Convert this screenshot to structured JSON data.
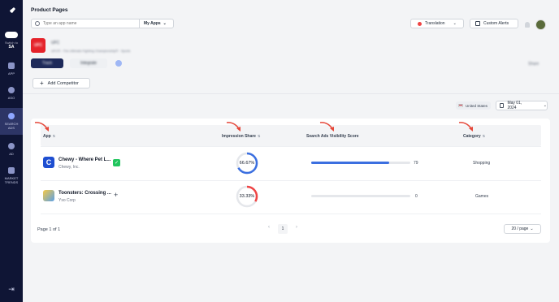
{
  "sidebar": {
    "switch_label": "Switch to",
    "switch_value": "SA",
    "items": [
      {
        "label": "APP",
        "icon": "app-icon"
      },
      {
        "label": "ASO",
        "icon": "aso-icon"
      },
      {
        "label": "SEARCH ADS",
        "icon": "search-ads-icon",
        "active": true
      },
      {
        "label": "AD",
        "icon": "ad-icon"
      },
      {
        "label": "MARKET TRENDS",
        "icon": "market-trends-icon"
      }
    ]
  },
  "header": {
    "title": "Product Pages",
    "search_placeholder": "Type an app name",
    "scope": "My Apps",
    "translation": "Translation",
    "custom_alerts": "Custom Alerts"
  },
  "app": {
    "icon_text": "UFC",
    "name": "UFC",
    "subtitle": "UFC® - The Ultimate Fighting Championship® · Sports",
    "track": "Track",
    "integrate": "Integrate",
    "share": "Share"
  },
  "add_competitor": "Add Competitor",
  "filters": {
    "country": "United States",
    "date": "May 01, 2024"
  },
  "table": {
    "columns": [
      "App",
      "Impression Share",
      "Search Ads Visibility Score",
      "Category"
    ],
    "rows": [
      {
        "name": "Chewy - Where Pet L...",
        "developer": "Chewy, Inc.",
        "impression_share": "66.67%",
        "share_value": 66.67,
        "score": "79",
        "score_value": 79,
        "category": "Shopping",
        "tracked": true
      },
      {
        "name": "Toonsters: Crossing ...",
        "developer": "Yso Corp",
        "impression_share": "33.33%",
        "share_value": 33.33,
        "score": "0",
        "score_value": 0,
        "category": "Games",
        "tracked": false
      }
    ]
  },
  "pagination": {
    "summary": "Page 1 of 1",
    "current": "1",
    "per_page": "20 / page"
  },
  "colors": {
    "sidebar": "#0f1535",
    "accent": "#3b6fe0",
    "donut_red": "#ef4444",
    "annotation": "#e5483a",
    "tracked": "#22c55e"
  }
}
